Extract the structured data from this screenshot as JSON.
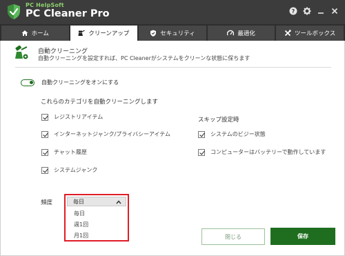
{
  "app": {
    "brand_small": "PC HelpSoft",
    "brand_large": "PC Cleaner Pro"
  },
  "titlebar_icons": [
    "help-icon",
    "gear-icon",
    "minimize-icon",
    "close-icon"
  ],
  "tabs": [
    {
      "label": "ホーム",
      "icon": "home-icon",
      "active": false
    },
    {
      "label": "クリーンアップ",
      "icon": "broom-icon",
      "active": true
    },
    {
      "label": "セキュリティ",
      "icon": "shield-icon",
      "active": false
    },
    {
      "label": "最適化",
      "icon": "speedometer-icon",
      "active": false
    },
    {
      "label": "ツールボックス",
      "icon": "tools-icon",
      "active": false
    }
  ],
  "header": {
    "title": "自動クリーニング",
    "description": "自動クリーニングを設定すれば、PC Cleanerがシステムをクリーンな状態に保ちます"
  },
  "toggle": {
    "label": "自動クリーニングをオンにする",
    "on": true
  },
  "categories": {
    "title": "これらのカテゴリを自動クリーニングします",
    "items": [
      {
        "label": "レジストリアイテム",
        "checked": true
      },
      {
        "label": "インターネットジャンク/プライバシーアイテム",
        "checked": true
      },
      {
        "label": "チャット履歴",
        "checked": true
      },
      {
        "label": "システムジャンク",
        "checked": true
      }
    ]
  },
  "skip": {
    "title": "スキップ設定時",
    "items": [
      {
        "label": "システムのビジー状態",
        "checked": true
      },
      {
        "label": "コンピューターはバッテリーで動作しています",
        "checked": true
      }
    ]
  },
  "frequency": {
    "label": "頻度",
    "selected": "毎日",
    "options": [
      "毎日",
      "週1回",
      "月1回"
    ]
  },
  "buttons": {
    "close": "閉じる",
    "save": "保存"
  },
  "colors": {
    "titlebar": "#3c3c3c",
    "brand_green": "#8ed06e",
    "accent_green": "#1f6e1f",
    "highlight_red": "#e01b24"
  }
}
